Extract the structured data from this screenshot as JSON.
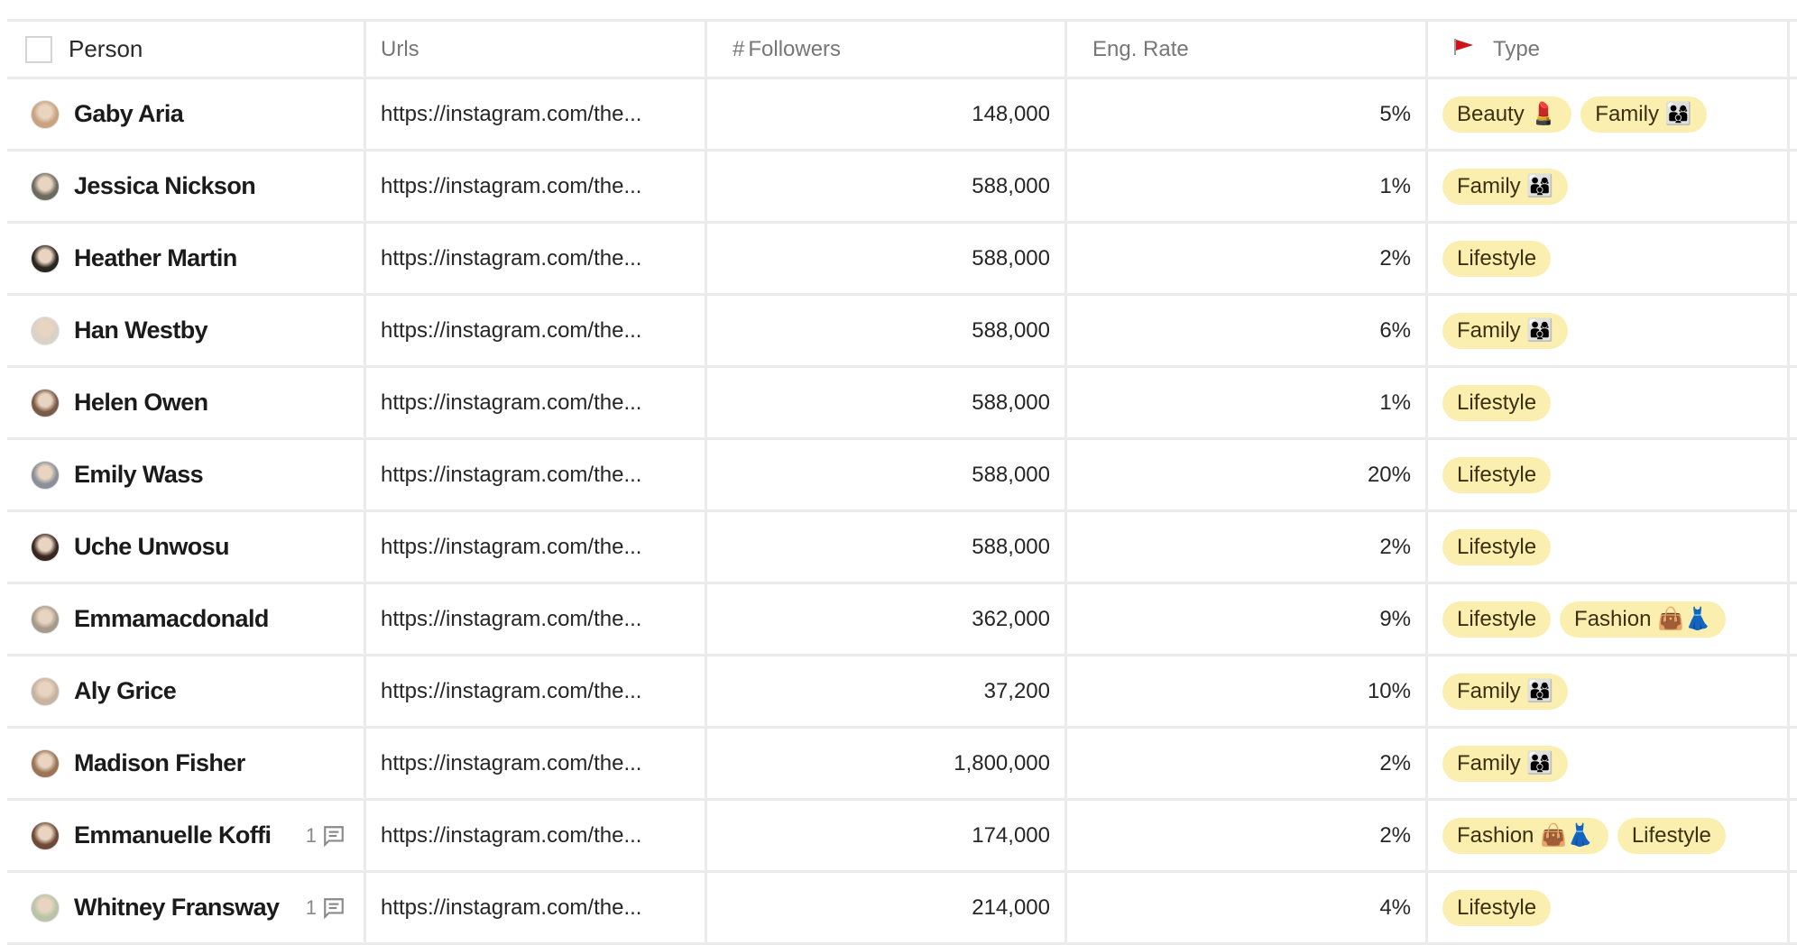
{
  "columns": {
    "person": "Person",
    "urls": "Urls",
    "followers_icon": "#",
    "followers": "Followers",
    "eng_rate": "Eng. Rate",
    "type_icon": "red-flag-icon",
    "type": "Type"
  },
  "rows": [
    {
      "name": "Gaby Aria",
      "url": "https://instagram.com/the...",
      "followers": "148,000",
      "eng_rate": "5%",
      "types": [
        "Beauty 💄",
        "Family 👨‍👩‍👦"
      ],
      "comments": null,
      "avatar_color": "#c9a27e"
    },
    {
      "name": "Jessica Nickson",
      "url": "https://instagram.com/the...",
      "followers": "588,000",
      "eng_rate": "1%",
      "types": [
        "Family 👨‍👩‍👦"
      ],
      "comments": null,
      "avatar_color": "#6b6b5e"
    },
    {
      "name": "Heather Martin",
      "url": "https://instagram.com/the...",
      "followers": "588,000",
      "eng_rate": "2%",
      "types": [
        "Lifestyle"
      ],
      "comments": null,
      "avatar_color": "#2b2620"
    },
    {
      "name": "Han Westby",
      "url": "https://instagram.com/the...",
      "followers": "588,000",
      "eng_rate": "6%",
      "types": [
        "Family 👨‍👩‍👦"
      ],
      "comments": null,
      "avatar_color": "#d9d2c8"
    },
    {
      "name": "Helen Owen",
      "url": "https://instagram.com/the...",
      "followers": "588,000",
      "eng_rate": "1%",
      "types": [
        "Lifestyle"
      ],
      "comments": null,
      "avatar_color": "#7a5b45"
    },
    {
      "name": "Emily Wass",
      "url": "https://instagram.com/the...",
      "followers": "588,000",
      "eng_rate": "20%",
      "types": [
        "Lifestyle"
      ],
      "comments": null,
      "avatar_color": "#8a8f9a"
    },
    {
      "name": "Uche Unwosu",
      "url": "https://instagram.com/the...",
      "followers": "588,000",
      "eng_rate": "2%",
      "types": [
        "Lifestyle"
      ],
      "comments": null,
      "avatar_color": "#3a2620"
    },
    {
      "name": "Emmamacdonald",
      "url": "https://instagram.com/the...",
      "followers": "362,000",
      "eng_rate": "9%",
      "types": [
        "Lifestyle",
        "Fashion 👜👗"
      ],
      "comments": null,
      "avatar_color": "#a89a8a"
    },
    {
      "name": "Aly Grice",
      "url": "https://instagram.com/the...",
      "followers": "37,200",
      "eng_rate": "10%",
      "types": [
        "Family 👨‍👩‍👦"
      ],
      "comments": null,
      "avatar_color": "#c8b2a0"
    },
    {
      "name": "Madison Fisher",
      "url": "https://instagram.com/the...",
      "followers": "1,800,000",
      "eng_rate": "2%",
      "types": [
        "Family 👨‍👩‍👦"
      ],
      "comments": null,
      "avatar_color": "#9a7455"
    },
    {
      "name": "Emmanuelle Koffi",
      "url": "https://instagram.com/the...",
      "followers": "174,000",
      "eng_rate": "2%",
      "types": [
        "Fashion 👜👗",
        "Lifestyle"
      ],
      "comments": "1",
      "avatar_color": "#6e4a36"
    },
    {
      "name": "Whitney Fransway",
      "url": "https://instagram.com/the...",
      "followers": "214,000",
      "eng_rate": "4%",
      "types": [
        "Lifestyle"
      ],
      "comments": "1",
      "avatar_color": "#b9c4a6"
    }
  ],
  "colors": {
    "chip_bg": "#fbefaf",
    "border": "#ebebeb",
    "flag": "#d0131b"
  }
}
